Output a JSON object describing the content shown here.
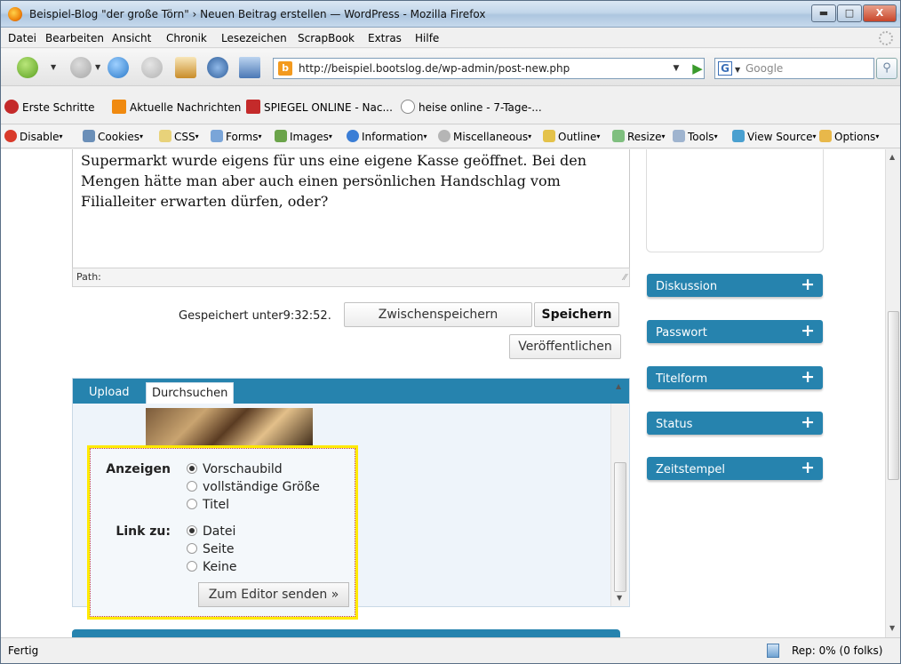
{
  "window": {
    "title": "Beispiel-Blog \"der große Törn\" › Neuen Beitrag erstellen — WordPress - Mozilla Firefox",
    "min_glyph": "▬",
    "max_glyph": "□",
    "close_glyph": "X"
  },
  "menu": [
    "Datei",
    "Bearbeiten",
    "Ansicht",
    "Chronik",
    "Lesezeichen",
    "ScrapBook",
    "Extras",
    "Hilfe"
  ],
  "nav": {
    "url": "http://beispiel.bootslog.de/wp-admin/post-new.php",
    "url_favicon": "b",
    "search_engine": "G",
    "search_placeholder": "Google"
  },
  "bookmarks": [
    {
      "label": "Erste Schritte",
      "color": "#c42a2a"
    },
    {
      "label": "Aktuelle Nachrichten",
      "color": "#f08a10"
    },
    {
      "label": "SPIEGEL ONLINE - Nac...",
      "color": "#c42a2a"
    },
    {
      "label": "heise online - 7-Tage-...",
      "color": "#888888"
    }
  ],
  "devbar": [
    {
      "label": "Disable",
      "color": "#d93a2a"
    },
    {
      "label": "Cookies",
      "color": "#6b8fb8"
    },
    {
      "label": "CSS",
      "color": "#e8d27a"
    },
    {
      "label": "Forms",
      "color": "#7aa5d8"
    },
    {
      "label": "Images",
      "color": "#6ba44a"
    },
    {
      "label": "Information",
      "color": "#3b7ed6"
    },
    {
      "label": "Miscellaneous",
      "color": "#b5b5b5"
    },
    {
      "label": "Outline",
      "color": "#e4c24a"
    },
    {
      "label": "Resize",
      "color": "#7fbf7f"
    },
    {
      "label": "Tools",
      "color": "#9fb4cf"
    },
    {
      "label": "View Source",
      "color": "#4aa0d0"
    },
    {
      "label": "Options",
      "color": "#e8b84a"
    }
  ],
  "editor": {
    "text": "Supermarkt wurde eigens für uns eine eigene Kasse geöffnet. Bei den Mengen hätte man aber auch einen persönlichen Handschlag vom Filialleiter erwarten dürfen, oder?",
    "path_label": "Path:"
  },
  "save": {
    "status": "Gespeichert unter9:32:52.",
    "draft_label": "Zwischenspeichern",
    "save_label": "Speichern",
    "publish_label": "Veröffentlichen"
  },
  "media": {
    "tabs": [
      "Upload",
      "Durchsuchen"
    ],
    "display_label": "Anzeigen",
    "display_options": [
      "Vorschaubild",
      "vollständige Größe",
      "Titel"
    ],
    "link_label": "Link zu:",
    "link_options": [
      "Datei",
      "Seite",
      "Keine"
    ],
    "send_label": "Zum Editor senden »"
  },
  "sidebar": {
    "panels": [
      "Diskussion",
      "Passwort",
      "Titelform",
      "Status",
      "Zeitstempel"
    ]
  },
  "status": {
    "text": "Fertig",
    "rep": "Rep: 0% (0 folks)"
  },
  "colors": {
    "wp_blue": "#2683ae",
    "highlight": "#ffea00"
  }
}
